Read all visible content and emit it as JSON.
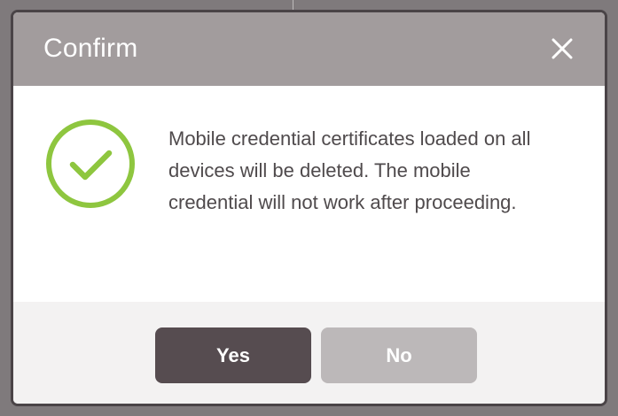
{
  "dialog": {
    "title": "Confirm",
    "close_icon": "close-icon",
    "status_icon": "check-circle-icon",
    "message": "Mobile credential certificates loaded on all devices will be deleted. The mobile credential will not work after proceeding.",
    "buttons": {
      "yes_label": "Yes",
      "no_label": "No"
    }
  },
  "colors": {
    "header_bg": "#a29c9d",
    "primary_button": "#564c50",
    "secondary_button": "#bcb8b9",
    "success_accent": "#8ec63f",
    "text": "#4f4a4c"
  }
}
